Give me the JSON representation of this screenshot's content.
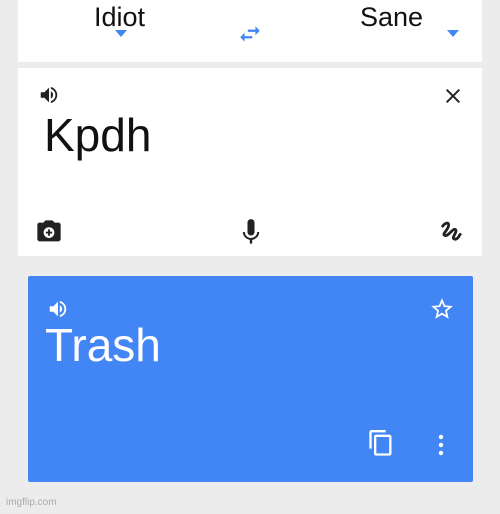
{
  "languages": {
    "source": "Idiot",
    "target": "Sane"
  },
  "input": {
    "text": "Kpdh"
  },
  "output": {
    "text": "Trash"
  },
  "icons": {
    "source_speaker": "volume-icon",
    "swap": "swap-languages-icon",
    "clear": "close-icon",
    "camera": "camera-icon",
    "voice": "microphone-icon",
    "handwriting": "handwriting-icon",
    "output_speaker": "volume-icon",
    "favorite": "star-icon",
    "copy": "copy-icon",
    "more": "more-vert-icon"
  },
  "colors": {
    "accent": "#4285f4",
    "icon_dark": "#222222",
    "card_background": "#ffffff",
    "output_text": "#ffffff"
  },
  "watermark": "imgflip.com"
}
